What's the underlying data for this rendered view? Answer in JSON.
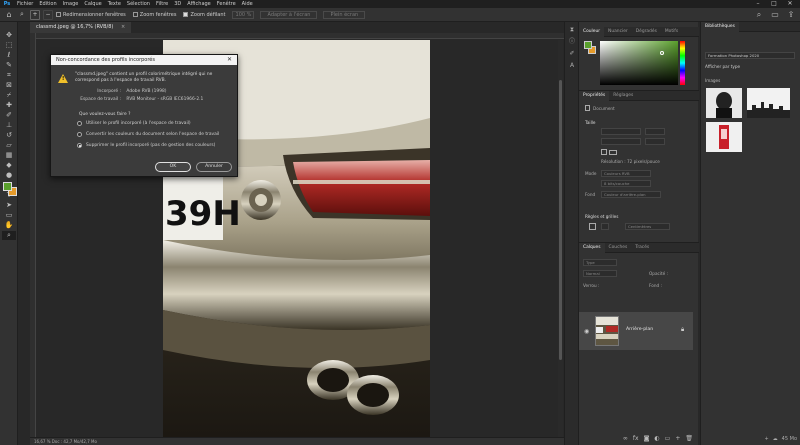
{
  "menu": {
    "logo": "Ps",
    "items": [
      "Fichier",
      "Edition",
      "Image",
      "Calque",
      "Texte",
      "Sélection",
      "Filtre",
      "3D",
      "Affichage",
      "Fenêtre",
      "Aide"
    ],
    "minimize": "–",
    "maximize": "□",
    "close": "✕"
  },
  "options_bar": {
    "resize_windows": "Redimensionner fenêtres",
    "zoom_all": "Zoom fenêtres",
    "scrubby_zoom": "Zoom défilant",
    "zoom_percent": "100 %",
    "fit_screen": "Adapter à l'écran",
    "fill_screen": "Plein écran"
  },
  "document_tab": {
    "title": "classmd.jpeg @ 16,7% (RVB/8)",
    "close": "×"
  },
  "status_bar": {
    "text": "16,67 %     Doc : 42,7 Mo/42,7 Mo"
  },
  "dialog": {
    "title": "Non-concordance des profils incorporés",
    "close": "✕",
    "warning_mark": "!",
    "message": "\"classmd.jpeg\" contient un profil colorimétrique intégré qui ne correspond pas à l'espace de travail RVB.",
    "embedded_label": "Incorporé :",
    "embedded_value": "Adobe RVB (1998)",
    "working_label": "Espace de travail :",
    "working_value": "RVB Moniteur - sRGB IEC61966-2.1",
    "question": "Que voulez-vous faire ?",
    "options": [
      "Utiliser le profil incorporé (à l'espace de travail)",
      "Convertir les couleurs du document selon l'espace de travail",
      "Supprimer le profil incorporé (pas de gestion des couleurs)"
    ],
    "selected_option": 2,
    "ok": "OK",
    "cancel": "Annuler"
  },
  "color_panel": {
    "tabs": [
      "Couleur",
      "Nuancier",
      "Dégradés",
      "Motifs"
    ],
    "foreground": "#5aa02c",
    "background": "#e59a2a"
  },
  "properties_panel": {
    "tabs": [
      "Propriétés",
      "Réglages"
    ],
    "document_label": "Document",
    "canvas_section": "Taille",
    "resolution": "Résolution : 72 pixels/pouce",
    "mode_label": "Mode",
    "mode_value": "Couleurs RVB",
    "depth_value": "8 bits/couche",
    "fill_label": "Fond",
    "fill_value": "Couleur d'arrière-plan",
    "rulers_section": "Règles et grilles",
    "unit_value": "Centimètres"
  },
  "layers_panel": {
    "tabs": [
      "Calques",
      "Couches",
      "Tracés"
    ],
    "filter_label": "Type",
    "blend_label": "Normal",
    "opacity_label": "Opacité :",
    "lock_label": "Verrou :",
    "fill_label": "Fond :",
    "layer_name": "Arrière-plan"
  },
  "libraries_panel": {
    "tabs": [
      "Bibliothèques"
    ],
    "library_name": "Formation Photoshop 2020",
    "view_label": "Afficher par type",
    "section": "Images",
    "storage": "45 Mo"
  },
  "toolbar": {
    "tools": [
      "move",
      "artboard",
      "marquee",
      "lasso",
      "quick-select",
      "crop",
      "frame",
      "eyedropper",
      "healing",
      "brush",
      "clone",
      "history-brush",
      "eraser",
      "gradient",
      "blur",
      "dodge",
      "pen",
      "type",
      "path-select",
      "shape",
      "hand",
      "zoom"
    ]
  }
}
